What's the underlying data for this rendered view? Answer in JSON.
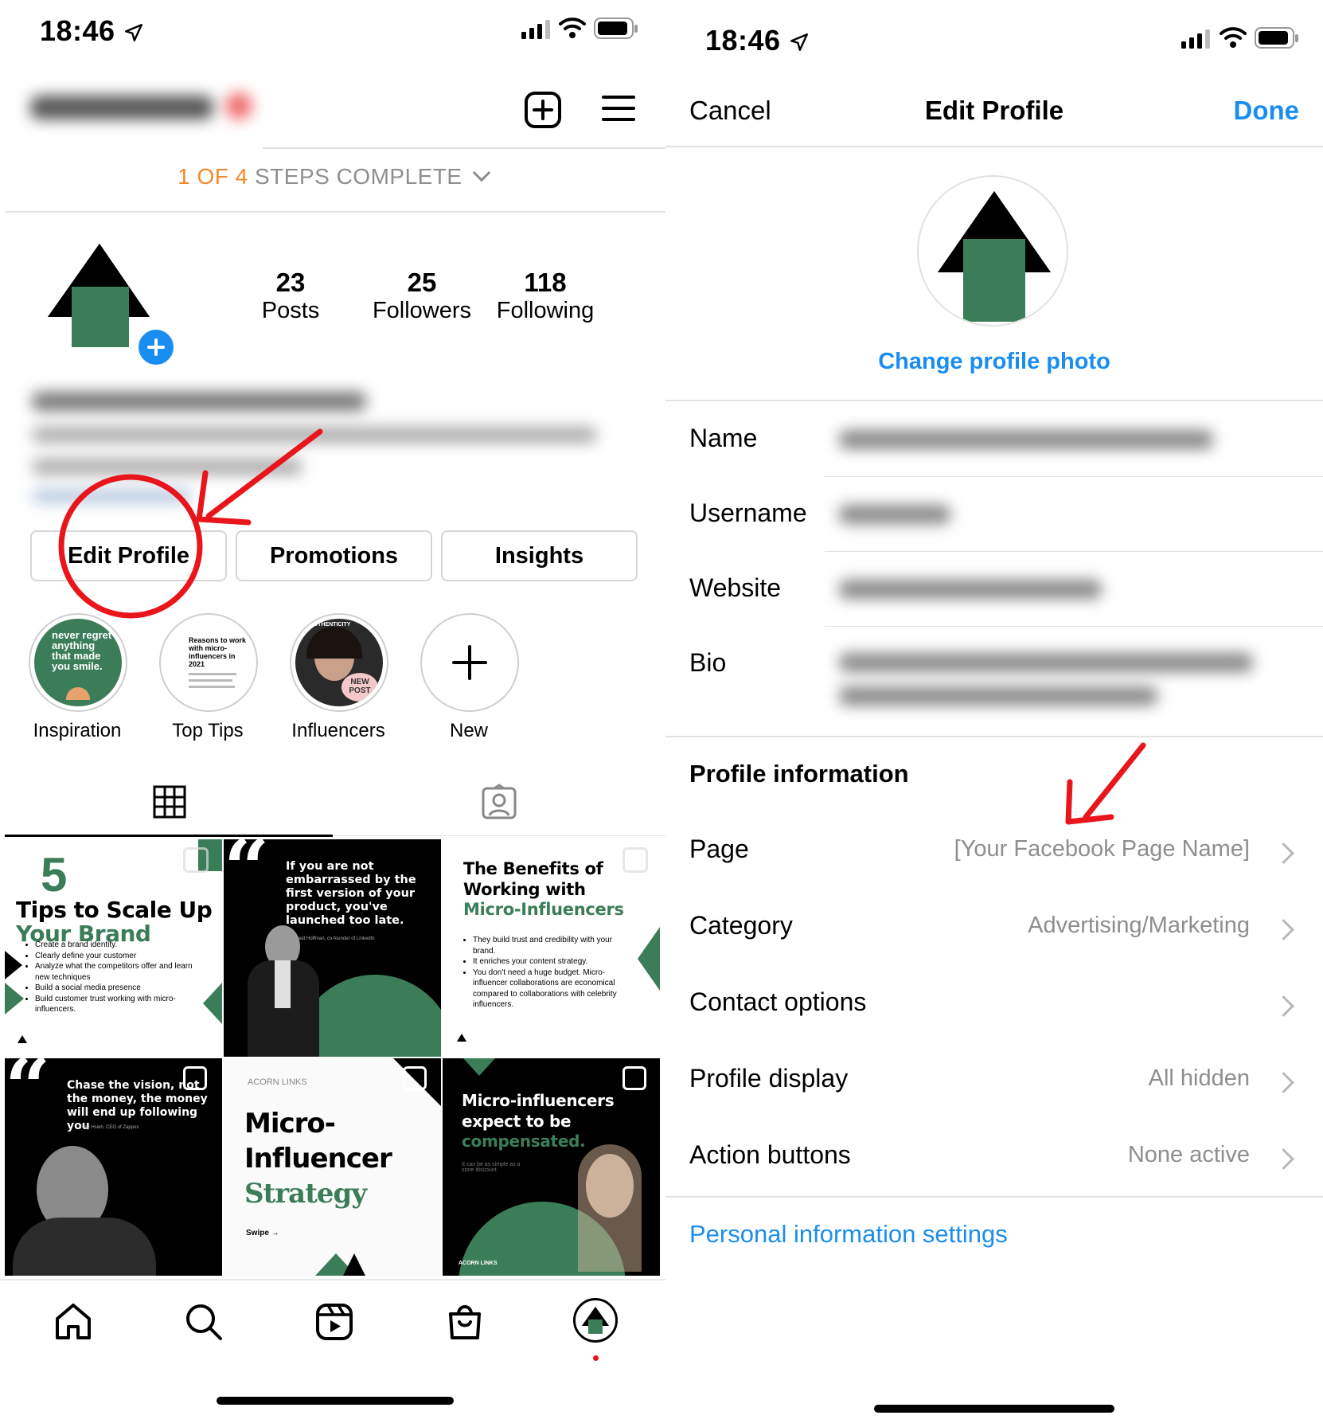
{
  "left": {
    "status_time": "18:46",
    "steps": {
      "highlight": "1 OF 4",
      "rest": "STEPS COMPLETE"
    },
    "stats": [
      {
        "count": "23",
        "label": "Posts"
      },
      {
        "count": "25",
        "label": "Followers"
      },
      {
        "count": "118",
        "label": "Following"
      }
    ],
    "buttons": {
      "edit_profile": "Edit Profile",
      "promotions": "Promotions",
      "insights": "Insights"
    },
    "highlights": [
      {
        "label": "Inspiration",
        "cover_text": "never regret anything that made you smile."
      },
      {
        "label": "Top Tips",
        "cover_text": "Reasons to work with micro-influencers in 2021"
      },
      {
        "label": "Influencers",
        "cover_text": "AUTHENTICITY",
        "badge": "NEW POST"
      },
      {
        "label": "New"
      }
    ],
    "posts": [
      {
        "big": "5",
        "title_dark": "Tips to Scale Up",
        "title_green": "Your Brand",
        "bullets": [
          "Create a brand identity.",
          "Clearly define your customer",
          "Analyze what the competitors offer and learn new techniques",
          "Build a social media presence",
          "Build customer trust working with micro-influencers."
        ]
      },
      {
        "quote": "If you are not embarrassed by the first version of your product, you've launched too late.",
        "credit": "Reid Hoffman, co-founder of LinkedIn"
      },
      {
        "title_dark": "The Benefits of Working with",
        "title_green": "Micro-Influencers",
        "bullets": [
          "They build trust and credibility with your brand.",
          "It enriches your content strategy.",
          "You don't need a huge budget. Micro-influencer collaborations are economical compared to collaborations with celebrity influencers."
        ]
      },
      {
        "quote": "Chase the vision, not the money, the money will end up following you",
        "credit": "Tony Hsieh, CEO of Zappos"
      },
      {
        "brand": "ACORN LINKS",
        "line1": "Micro-",
        "line2": "Influencer",
        "line3": "Strategy",
        "swipe": "Swipe"
      },
      {
        "title_white": "Micro-influencers expect to be",
        "title_green": "compensated.",
        "sub": "It can be as simple as a store discount.",
        "brand": "ACORN LINKS"
      }
    ]
  },
  "right": {
    "status_time": "18:46",
    "nav": {
      "cancel": "Cancel",
      "title": "Edit Profile",
      "done": "Done"
    },
    "change_photo": "Change profile photo",
    "fields": [
      {
        "label": "Name"
      },
      {
        "label": "Username"
      },
      {
        "label": "Website"
      },
      {
        "label": "Bio"
      }
    ],
    "profile_info_header": "Profile information",
    "rows": [
      {
        "label": "Page",
        "value": "[Your Facebook Page Name]"
      },
      {
        "label": "Category",
        "value": "Advertising/Marketing"
      },
      {
        "label": "Contact options",
        "value": ""
      },
      {
        "label": "Profile display",
        "value": "All hidden"
      },
      {
        "label": "Action buttons",
        "value": "None active"
      }
    ],
    "personal_settings": "Personal information settings"
  },
  "colors": {
    "accent": "#1a8ef0",
    "brand_green": "#3b7d58",
    "steps_orange": "#f58a2b",
    "annotation_red": "#e8151b"
  }
}
